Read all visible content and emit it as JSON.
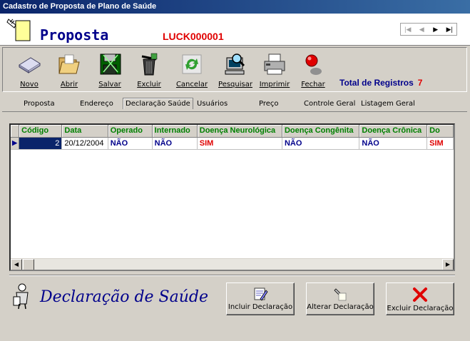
{
  "window": {
    "title": "Cadastro de Proposta de Plano de Saúde"
  },
  "header": {
    "title": "Proposta",
    "code": "LUCK000001"
  },
  "nav": {
    "first": "|◀",
    "prev": "◀",
    "next": "▶",
    "last": "▶|"
  },
  "toolbar": {
    "novo": "Novo",
    "abrir": "Abrir",
    "salvar": "Salvar",
    "excluir": "Excluir",
    "cancelar": "Cancelar",
    "pesquisar": "Pesquisar",
    "imprimir": "Imprimir",
    "fechar": "Fechar",
    "total_label": "Total de Registros",
    "total_value": "7"
  },
  "tabs": [
    "Proposta",
    "Endereço",
    "Declaração Saúde",
    "Usuários",
    "Preço",
    "Controle Geral",
    "Listagem Geral"
  ],
  "grid": {
    "columns": [
      "Código",
      "Data",
      "Operado",
      "Internado",
      "Doença Neurológica",
      "Doença Congênita",
      "Doença Crônica",
      "Do"
    ],
    "row": {
      "codigo": "2",
      "data": "20/12/2004",
      "operado": "NÃO",
      "internado": "NÃO",
      "neuro": "SIM",
      "congenita": "NÃO",
      "cronica": "NÃO",
      "extra": "SIM"
    }
  },
  "section": {
    "title": "Declaração de Saúde"
  },
  "buttons": {
    "incluir": "Incluir Declaração",
    "alterar": "Alterar Declaração",
    "excluir": "Excluir Declaração"
  },
  "colors": {
    "accent": "#00008b",
    "alert": "#e00000",
    "header_green": "#008000"
  },
  "icons": [
    "document-hand-icon",
    "new-icon",
    "folder-icon",
    "save-icon",
    "trash-icon",
    "recycle-icon",
    "search-computer-icon",
    "printer-icon",
    "red-light-icon",
    "edit-icon",
    "red-x-icon"
  ]
}
